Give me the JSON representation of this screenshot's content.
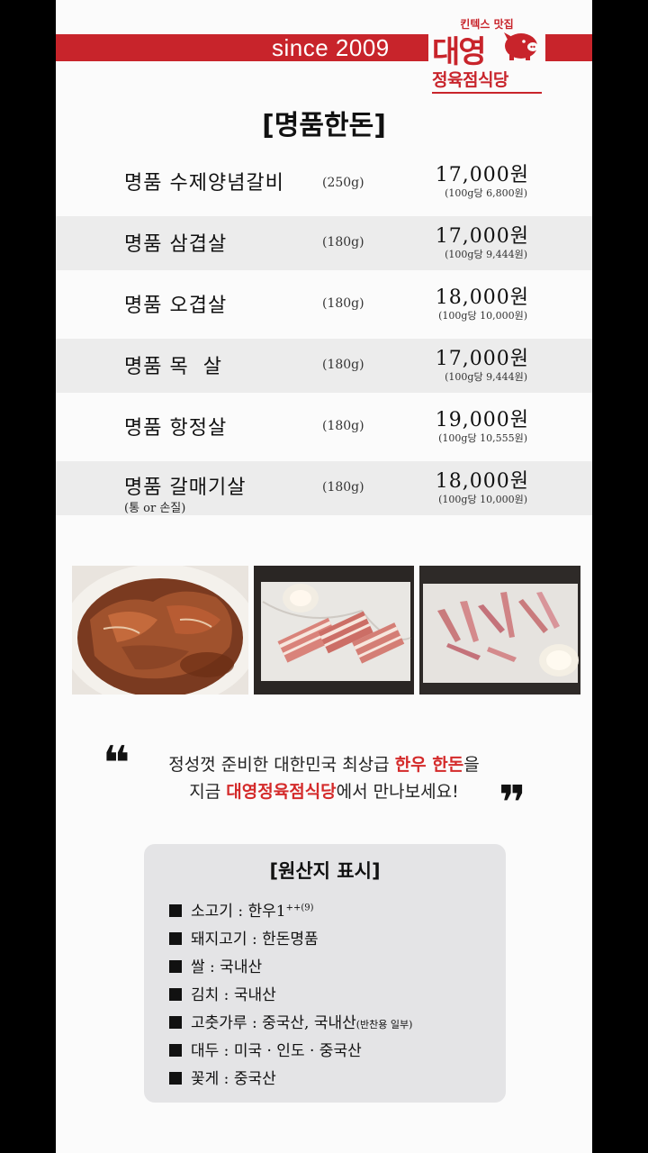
{
  "header": {
    "since": "since 2009",
    "logo_tagline": "킨텍스 맛집",
    "logo_name": "대영",
    "logo_sub": "정육점식당"
  },
  "section_title": "[명품한돈]",
  "menu": [
    {
      "name": "명품 수제양념갈비",
      "weight": "(250g)",
      "price": "17,000원",
      "unit_price": "(100g당 6,800원)",
      "note": ""
    },
    {
      "name": "명품 삼겹살",
      "weight": "(180g)",
      "price": "17,000원",
      "unit_price": "(100g당 9,444원)",
      "note": ""
    },
    {
      "name": "명품 오겹살",
      "weight": "(180g)",
      "price": "18,000원",
      "unit_price": "(100g당 10,000원)",
      "note": ""
    },
    {
      "name": "명품 목  살",
      "weight": "(180g)",
      "price": "17,000원",
      "unit_price": "(100g당 9,444원)",
      "note": ""
    },
    {
      "name": "명품 항정살",
      "weight": "(180g)",
      "price": "19,000원",
      "unit_price": "(100g당 10,555원)",
      "note": ""
    },
    {
      "name": "명품 갈매기살",
      "weight": "(180g)",
      "price": "18,000원",
      "unit_price": "(100g당 10,000원)",
      "note": "(통 or 손질)"
    }
  ],
  "quote": {
    "open_mark": "❝",
    "close_mark": "❞",
    "line1_pre": "정성껏 준비한 대한민국 최상급 ",
    "line1_red": "한우 한돈",
    "line1_post": "을",
    "line2_pre": "지금 ",
    "line2_red": "대영정육점식당",
    "line2_post": "에서 만나보세요!"
  },
  "origin": {
    "title": "[원산지 표시]",
    "items": [
      {
        "text": "소고기 : 한우1",
        "sup": "++(9)",
        "small": ""
      },
      {
        "text": "돼지고기 : 한돈명품",
        "sup": "",
        "small": ""
      },
      {
        "text": "쌀 : 국내산",
        "sup": "",
        "small": ""
      },
      {
        "text": "김치 : 국내산",
        "sup": "",
        "small": ""
      },
      {
        "text": "고춧가루 : 중국산, 국내산",
        "sup": "",
        "small": "(반찬용 일부)"
      },
      {
        "text": "대두 : 미국 · 인도 · 중국산",
        "sup": "",
        "small": ""
      },
      {
        "text": "꽃게 : 중국산",
        "sup": "",
        "small": ""
      }
    ]
  },
  "colors": {
    "brand_red": "#c8242b",
    "highlight_red": "#d42a2a",
    "box_gray": "#e4e4e6"
  }
}
